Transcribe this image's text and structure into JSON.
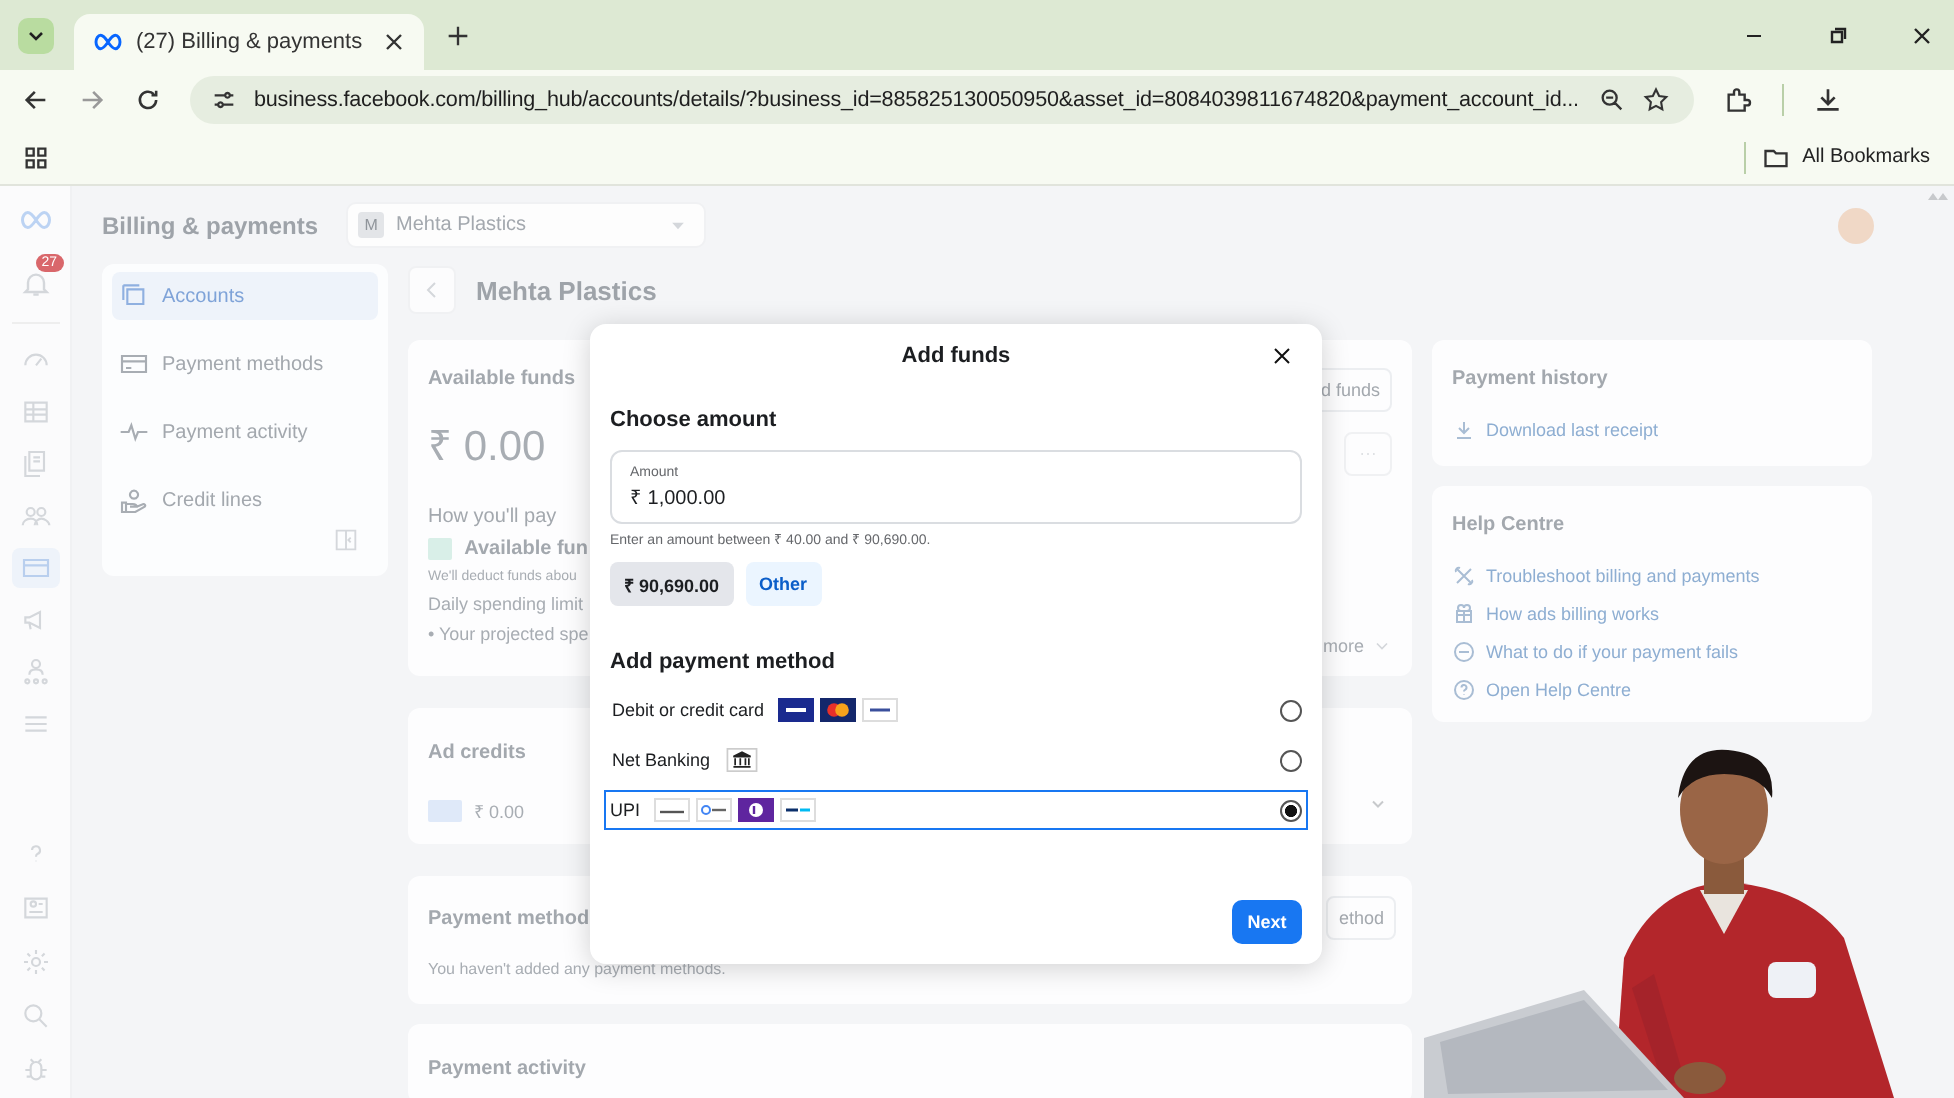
{
  "browser": {
    "tab": {
      "title": "(27) Billing & payments",
      "selected": true
    },
    "url": "business.facebook.com/billing_hub/accounts/details/?business_id=885825130050950&asset_id=8084039811674820&payment_account_id...",
    "bookmarks": [
      {
        "label": "All Bookmarks"
      }
    ]
  },
  "rail": {
    "badge": "27",
    "items": [
      {
        "selected": false
      },
      {
        "selected": false
      },
      {
        "selected": false
      },
      {
        "selected": false
      },
      {
        "selected": true
      },
      {
        "selected": false
      },
      {
        "selected": false
      },
      {
        "selected": false
      }
    ]
  },
  "header": {
    "title": "Billing & payments",
    "account": {
      "initial": "M",
      "name": "Mehta Plastics"
    }
  },
  "nav": [
    {
      "label": "Accounts",
      "selected": true
    },
    {
      "label": "Payment methods",
      "selected": false
    },
    {
      "label": "Payment activity",
      "selected": false
    },
    {
      "label": "Credit lines",
      "selected": false
    }
  ],
  "main": {
    "title": "Mehta Plastics",
    "funds_card": {
      "title": "Available funds",
      "amount": "₹ 0.00",
      "button": "d funds",
      "how_title": "How you'll pay",
      "method": "Available fun",
      "note": "We'll deduct funds abou",
      "limit": "Daily spending limit",
      "bullet": "• Your projected spe",
      "more": "more"
    },
    "ad_credits": {
      "title": "Ad credits",
      "amount": "₹ 0.00"
    },
    "payment_methods": {
      "title": "Payment method",
      "empty": "You haven't added any payment methods.",
      "button": "ethod"
    },
    "payment_activity": {
      "title": "Payment activity"
    }
  },
  "right": {
    "history": {
      "title": "Payment history",
      "link": "Download last receipt"
    },
    "help": {
      "title": "Help Centre",
      "links": [
        "Troubleshoot billing and payments",
        "How ads billing works",
        "What to do if your payment fails",
        "Open Help Centre"
      ]
    }
  },
  "dialog": {
    "title": "Add funds",
    "amount_section": "Choose amount",
    "field": {
      "label": "Amount",
      "value": "₹ 1,000.00"
    },
    "hint": "Enter an amount between ₹ 40.00 and ₹ 90,690.00.",
    "chips": [
      {
        "label": "₹ 90,690.00",
        "kind": "preset"
      },
      {
        "label": "Other",
        "kind": "other"
      }
    ],
    "method_section": "Add payment method",
    "methods": [
      {
        "label": "Debit or credit card",
        "kind": "card",
        "selected": false
      },
      {
        "label": "Net Banking",
        "kind": "bank",
        "selected": false
      },
      {
        "label": "UPI",
        "kind": "upi",
        "selected": true
      }
    ],
    "button": "Next"
  }
}
